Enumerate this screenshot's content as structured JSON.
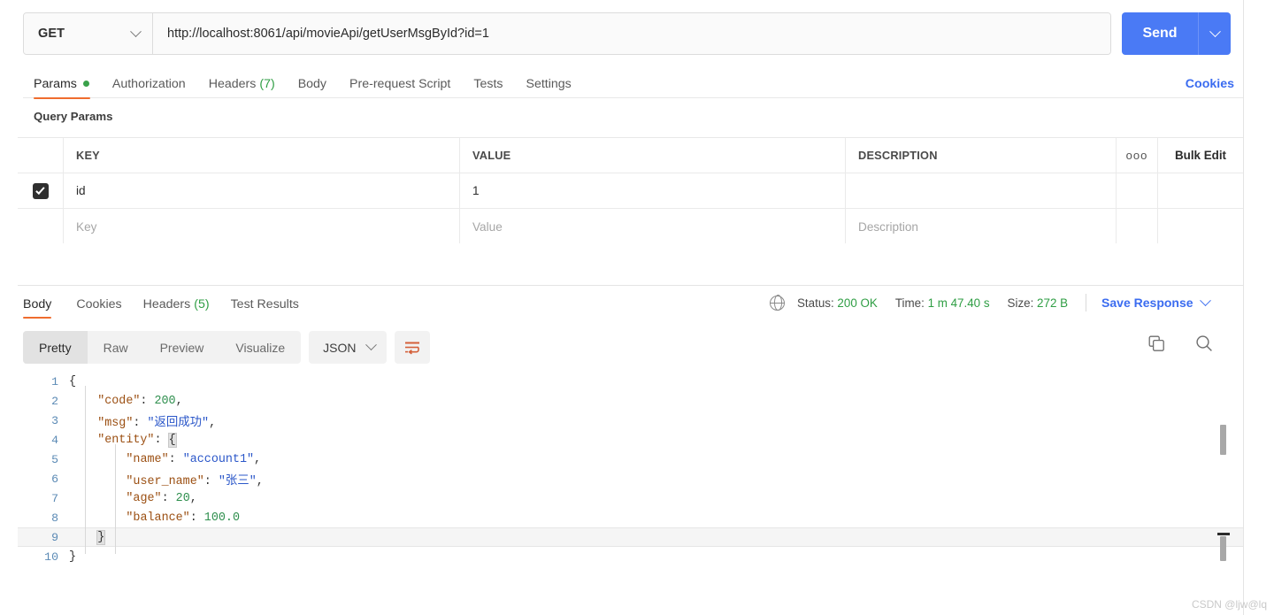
{
  "request": {
    "method": "GET",
    "url": "http://localhost:8061/api/movieApi/getUserMsgById?id=1",
    "send_label": "Send"
  },
  "request_tabs": [
    {
      "label": "Params",
      "badge": "dot",
      "active": true
    },
    {
      "label": "Authorization",
      "badge": "",
      "active": false
    },
    {
      "label": "Headers",
      "badge": "(7)",
      "active": false
    },
    {
      "label": "Body",
      "badge": "",
      "active": false
    },
    {
      "label": "Pre-request Script",
      "badge": "",
      "active": false
    },
    {
      "label": "Tests",
      "badge": "",
      "active": false
    },
    {
      "label": "Settings",
      "badge": "",
      "active": false
    }
  ],
  "cookies_link": "Cookies",
  "query_params": {
    "title": "Query Params",
    "headers": [
      "KEY",
      "VALUE",
      "DESCRIPTION"
    ],
    "options_icon": "ooo",
    "bulk_edit": "Bulk Edit",
    "rows": [
      {
        "checked": true,
        "key": "id",
        "value": "1",
        "description": ""
      }
    ],
    "placeholder_row": {
      "key": "Key",
      "value": "Value",
      "description": "Description"
    }
  },
  "response_tabs": [
    {
      "label": "Body",
      "badge": "",
      "active": true
    },
    {
      "label": "Cookies",
      "badge": "",
      "active": false
    },
    {
      "label": "Headers",
      "badge": "(5)",
      "active": false
    },
    {
      "label": "Test Results",
      "badge": "",
      "active": false
    }
  ],
  "response_meta": {
    "status_label": "Status:",
    "status_value": "200 OK",
    "time_label": "Time:",
    "time_value": "1 m 47.40 s",
    "size_label": "Size:",
    "size_value": "272 B",
    "save_response": "Save Response"
  },
  "body_toolbar": {
    "views": [
      "Pretty",
      "Raw",
      "Preview",
      "Visualize"
    ],
    "active_view": "Pretty",
    "format": "JSON",
    "wrap_icon": "word-wrap-icon",
    "copy_icon": "copy-icon",
    "search_icon": "search-icon"
  },
  "response_body": {
    "language": "json",
    "lines": [
      {
        "n": "1",
        "indent": 0,
        "tokens": [
          {
            "t": "pun",
            "v": "{",
            "brace": false
          }
        ]
      },
      {
        "n": "2",
        "indent": 1,
        "tokens": [
          {
            "t": "key",
            "v": "\"code\""
          },
          {
            "t": "pun",
            "v": ": "
          },
          {
            "t": "num",
            "v": "200"
          },
          {
            "t": "pun",
            "v": ","
          }
        ]
      },
      {
        "n": "3",
        "indent": 1,
        "tokens": [
          {
            "t": "key",
            "v": "\"msg\""
          },
          {
            "t": "pun",
            "v": ": "
          },
          {
            "t": "str",
            "v": "\"返回成功\""
          },
          {
            "t": "pun",
            "v": ","
          }
        ]
      },
      {
        "n": "4",
        "indent": 1,
        "tokens": [
          {
            "t": "key",
            "v": "\"entity\""
          },
          {
            "t": "pun",
            "v": ": "
          },
          {
            "t": "pun",
            "v": "{",
            "brace": true
          }
        ]
      },
      {
        "n": "5",
        "indent": 2,
        "tokens": [
          {
            "t": "key",
            "v": "\"name\""
          },
          {
            "t": "pun",
            "v": ": "
          },
          {
            "t": "str",
            "v": "\"account1\""
          },
          {
            "t": "pun",
            "v": ","
          }
        ]
      },
      {
        "n": "6",
        "indent": 2,
        "tokens": [
          {
            "t": "key",
            "v": "\"user_name\""
          },
          {
            "t": "pun",
            "v": ": "
          },
          {
            "t": "str",
            "v": "\"张三\""
          },
          {
            "t": "pun",
            "v": ","
          }
        ]
      },
      {
        "n": "7",
        "indent": 2,
        "tokens": [
          {
            "t": "key",
            "v": "\"age\""
          },
          {
            "t": "pun",
            "v": ": "
          },
          {
            "t": "num",
            "v": "20"
          },
          {
            "t": "pun",
            "v": ","
          }
        ]
      },
      {
        "n": "8",
        "indent": 2,
        "tokens": [
          {
            "t": "key",
            "v": "\"balance\""
          },
          {
            "t": "pun",
            "v": ": "
          },
          {
            "t": "num",
            "v": "100.0"
          }
        ]
      },
      {
        "n": "9",
        "indent": 1,
        "tokens": [
          {
            "t": "pun",
            "v": "}",
            "brace": true
          }
        ],
        "highlight": true
      },
      {
        "n": "10",
        "indent": 0,
        "tokens": [
          {
            "t": "pun",
            "v": "}",
            "brace": false
          }
        ]
      }
    ]
  },
  "watermark": "CSDN @ljw@lq",
  "colors": {
    "accent_orange": "#ef6c2e",
    "link_blue": "#3b6cf0",
    "send_blue": "#4a7af5",
    "status_green": "#2f9e44",
    "json_key": "#9b4f12",
    "json_string": "#2b57c9",
    "json_number": "#2f8f4e"
  }
}
